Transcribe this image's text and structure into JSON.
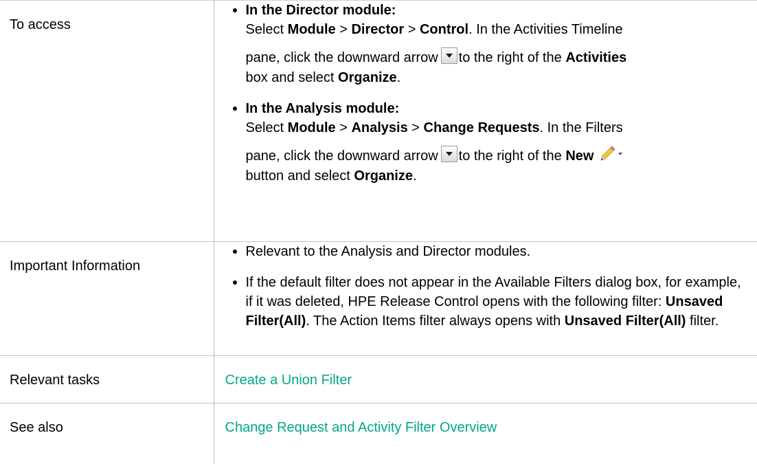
{
  "rows": {
    "access": {
      "label": "To access",
      "director": {
        "heading": "In the Director module:",
        "select": "Select",
        "module": "Module",
        "gt": ">",
        "director": "Director",
        "control": "Control",
        "after_control": ". In the Activities Timeline",
        "pane_click": "pane, click the downward arrow",
        "to_right": "to the right of the",
        "activities": "Activities",
        "box_select": "box and select",
        "organize": "Organize",
        "period": "."
      },
      "analysis": {
        "heading": "In the Analysis module:",
        "select": "Select",
        "module": "Module",
        "gt": ">",
        "analysis": "Analysis",
        "change_requests": "Change Requests",
        "after_cr": ". In the Filters",
        "pane_click": "pane, click the downward arrow",
        "to_right": "to the right of the",
        "new": "New",
        "button_select": "button and select",
        "organize": "Organize",
        "period": "."
      }
    },
    "important": {
      "label": "Important Information",
      "bullet1": "Relevant to the Analysis and Director modules.",
      "bullet2_part1": "If the default filter does not appear in the Available Filters dialog box, for example, if it was deleted, HPE Release Control opens with the following filter:",
      "unsaved1": "Unsaved Filter(All)",
      "bullet2_part2": ". The Action Items filter always opens with",
      "unsaved2": "Unsaved Filter(All)",
      "bullet2_part3": "filter."
    },
    "tasks": {
      "label": "Relevant tasks",
      "link": "Create a Union Filter"
    },
    "seealso": {
      "label": "See also",
      "link": "Change Request and Activity Filter Overview"
    }
  },
  "colors": {
    "link": "#01a982",
    "border": "#bfbfbf"
  },
  "icons": [
    "dropdown-arrow-icon",
    "pencil-icon"
  ]
}
